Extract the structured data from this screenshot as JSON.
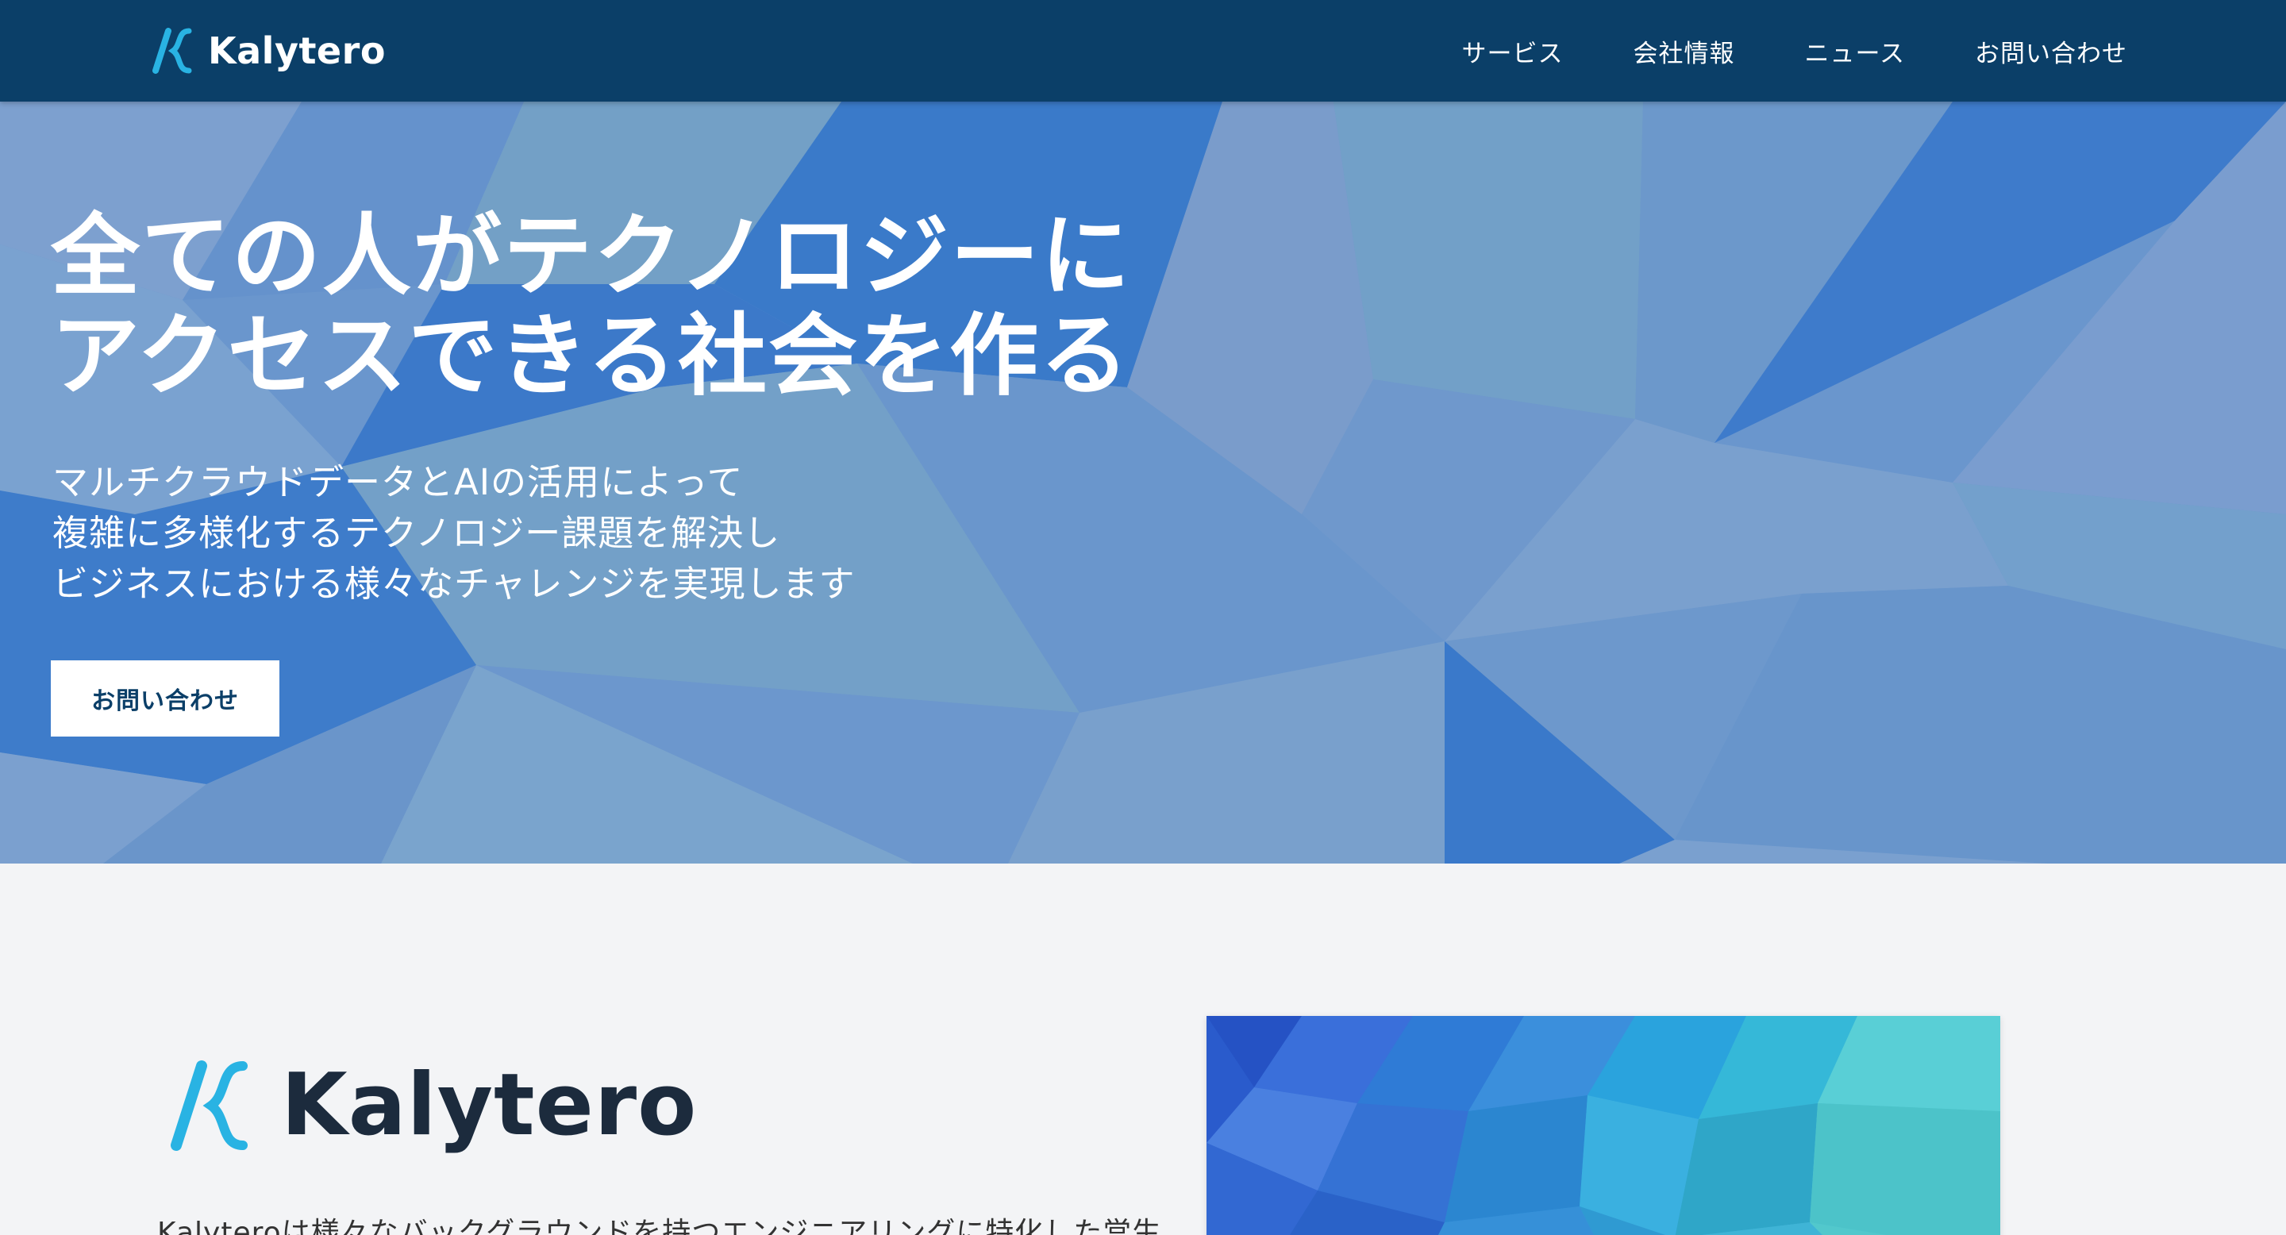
{
  "header": {
    "brand_name": "Kalytero",
    "nav": [
      {
        "label": "サービス"
      },
      {
        "label": "会社情報"
      },
      {
        "label": "ニュース"
      },
      {
        "label": "お問い合わせ"
      }
    ]
  },
  "hero": {
    "title_lines": [
      "全ての人がテクノロジーに",
      "アクセスできる社会を作る"
    ],
    "subtitle_lines": [
      "マルチクラウドデータとAIの活用によって",
      "複雑に多様化するテクノロジー課題を解決し",
      "ビジネスにおける様々なチャレンジを実現します"
    ],
    "cta_label": "お問い合わせ"
  },
  "about": {
    "logo_name": "Kalytero",
    "text": "Kalyteroは様々なバックグラウンドを持つエンジニアリングに特化した営生"
  },
  "colors": {
    "header_bg": "#0b3f68",
    "accent_cyan": "#29b3e3",
    "page_bg": "#f3f4f6"
  },
  "icons": {
    "brand_logo": "kalytero-logo-icon"
  }
}
